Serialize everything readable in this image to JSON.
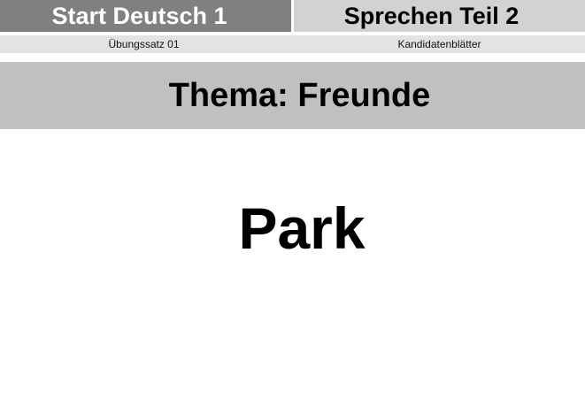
{
  "header": {
    "exam_title": "Start Deutsch 1",
    "section_title": "Sprechen Teil 2",
    "exercise_set": "Übungssatz 01",
    "sheet_type": "Kandidatenblätter"
  },
  "theme": {
    "label": "Thema: Freunde"
  },
  "card": {
    "word": "Park"
  },
  "colors": {
    "header_left_bg": "#808080",
    "header_right_bg": "#d2d2d2",
    "sub_row_bg": "#e3e3e3",
    "theme_band_bg": "#c0c0c0"
  }
}
